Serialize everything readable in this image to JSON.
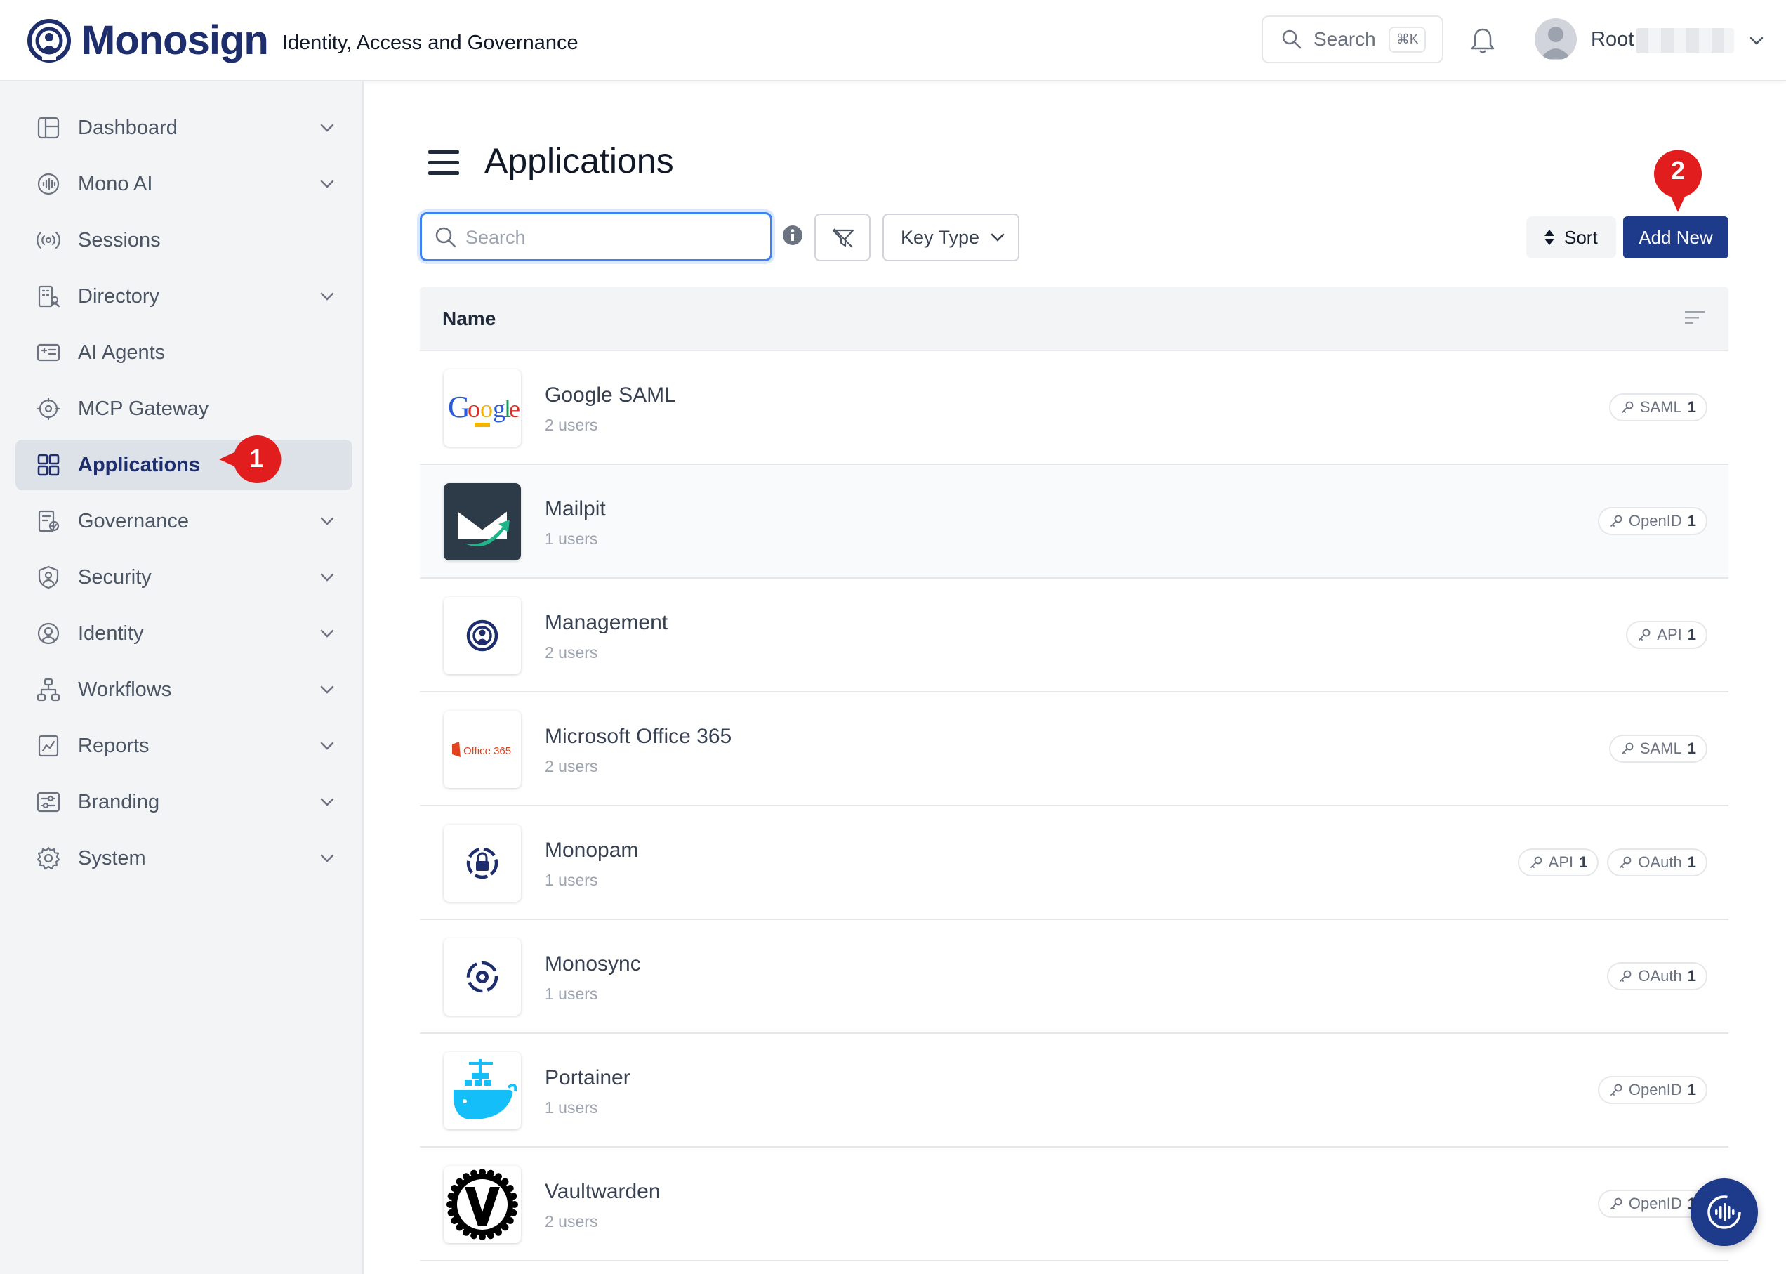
{
  "header": {
    "brand": "Monosign",
    "tagline": "Identity, Access and Governance",
    "search_label": "Search",
    "search_shortcut": "⌘K",
    "user_name": "Root",
    "brand_color": "#1e2d6b"
  },
  "sidebar": {
    "items": [
      {
        "label": "Dashboard",
        "icon": "dashboard-icon",
        "chevron": true
      },
      {
        "label": "Mono AI",
        "icon": "mono-ai-icon",
        "chevron": true
      },
      {
        "label": "Sessions",
        "icon": "broadcast-icon",
        "chevron": false
      },
      {
        "label": "Directory",
        "icon": "building-icon",
        "chevron": true
      },
      {
        "label": "AI Agents",
        "icon": "id-card-icon",
        "chevron": false
      },
      {
        "label": "MCP Gateway",
        "icon": "gateway-icon",
        "chevron": false
      },
      {
        "label": "Applications",
        "icon": "grid-icon",
        "chevron": false,
        "active": true
      },
      {
        "label": "Governance",
        "icon": "governance-icon",
        "chevron": true
      },
      {
        "label": "Security",
        "icon": "shield-user-icon",
        "chevron": true
      },
      {
        "label": "Identity",
        "icon": "user-circle-icon",
        "chevron": true
      },
      {
        "label": "Workflows",
        "icon": "workflow-icon",
        "chevron": true
      },
      {
        "label": "Reports",
        "icon": "report-icon",
        "chevron": true
      },
      {
        "label": "Branding",
        "icon": "sliders-icon",
        "chevron": true
      },
      {
        "label": "System",
        "icon": "gear-icon",
        "chevron": true
      }
    ]
  },
  "markers": {
    "one": "1",
    "two": "2",
    "color": "#e11d1d"
  },
  "main": {
    "title": "Applications",
    "search_placeholder": "Search",
    "key_type_label": "Key Type",
    "sort_label": "Sort",
    "add_label": "Add New",
    "column_name": "Name",
    "apps": [
      {
        "name": "Google SAML",
        "users": "2 users",
        "logo": "google-groups-logo",
        "badges": [
          {
            "type": "SAML",
            "count": "1"
          }
        ]
      },
      {
        "name": "Mailpit",
        "users": "1 users",
        "logo": "mailpit-logo",
        "badges": [
          {
            "type": "OpenID",
            "count": "1"
          }
        ]
      },
      {
        "name": "Management",
        "users": "2 users",
        "logo": "monosign-logo",
        "badges": [
          {
            "type": "API",
            "count": "1"
          }
        ]
      },
      {
        "name": "Microsoft Office 365",
        "users": "2 users",
        "logo": "office365-logo",
        "logo_text": "Office 365",
        "badges": [
          {
            "type": "SAML",
            "count": "1"
          }
        ]
      },
      {
        "name": "Monopam",
        "users": "1 users",
        "logo": "monopam-logo",
        "badges": [
          {
            "type": "API",
            "count": "1"
          },
          {
            "type": "OAuth",
            "count": "1"
          }
        ]
      },
      {
        "name": "Monosync",
        "users": "1 users",
        "logo": "monosync-logo",
        "badges": [
          {
            "type": "OAuth",
            "count": "1"
          }
        ]
      },
      {
        "name": "Portainer",
        "users": "1 users",
        "logo": "portainer-logo",
        "badges": [
          {
            "type": "OpenID",
            "count": "1"
          }
        ]
      },
      {
        "name": "Vaultwarden",
        "users": "2 users",
        "logo": "vaultwarden-logo",
        "badges": [
          {
            "type": "OpenID",
            "count": "1"
          }
        ]
      }
    ]
  },
  "colors": {
    "primary_button": "#1e3a8a",
    "focus": "#3b82f6",
    "sidebar_bg": "#f3f4f6"
  }
}
